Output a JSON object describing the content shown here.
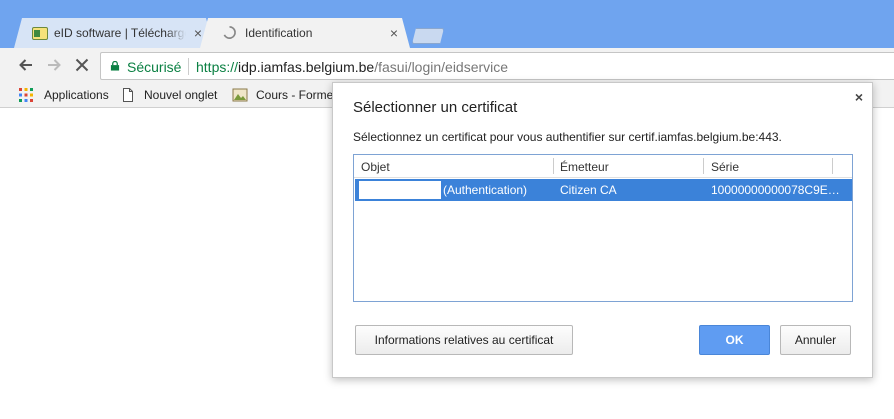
{
  "tabs": [
    {
      "title": "eID software | Téléchargement",
      "close": "×",
      "icon": "eid-favicon",
      "active": false
    },
    {
      "title": "Identification",
      "close": "×",
      "icon": "loading-spinner-icon",
      "active": true
    }
  ],
  "omnibox": {
    "secure_label": "Sécurisé",
    "url_scheme": "https://",
    "url_host": "idp.iamfas.belgium.be",
    "url_path": "/fasui/login/eidservice"
  },
  "bookmarks": [
    {
      "label": "Applications",
      "icon": "apps-grid-icon"
    },
    {
      "label": "Nouvel onglet",
      "icon": "page-icon"
    },
    {
      "label": "Cours - Formet",
      "icon": "image-icon"
    }
  ],
  "dialog": {
    "title": "Sélectionner un certificat",
    "close": "×",
    "description": "Sélectionnez un certificat pour vous authentifier sur certif.iamfas.belgium.be:443.",
    "columns": [
      "Objet",
      "Émetteur",
      "Série"
    ],
    "rows": [
      {
        "object": "(Authentication)",
        "issuer": "Citizen CA",
        "serial": "10000000000078C9E…"
      }
    ],
    "info_button": "Informations relatives au certificat",
    "ok_button": "OK",
    "cancel_button": "Annuler"
  },
  "colors": {
    "tabstrip": "#6fa4ef",
    "secure_green": "#0b8043",
    "selection_blue": "#3b82d9",
    "ok_blue": "#5f9cf2"
  }
}
